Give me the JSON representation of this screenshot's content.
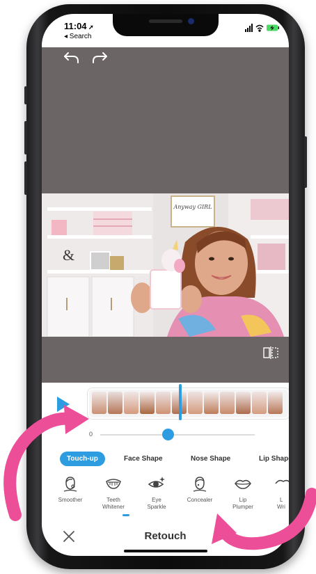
{
  "status_bar": {
    "time": "11:04",
    "back_label": "◂ Search"
  },
  "editor": {
    "undo_icon": "undo-icon",
    "redo_icon": "redo-icon",
    "compare_icon": "compare-split-icon",
    "video_sign_text": "Anyway GIRL"
  },
  "timeline": {
    "play_icon": "play-icon"
  },
  "slider": {
    "min_label": "0",
    "value_fraction": 0.44
  },
  "tabs": [
    {
      "label": "Touch-up",
      "active": true
    },
    {
      "label": "Face Shape",
      "active": false
    },
    {
      "label": "Nose Shape",
      "active": false
    },
    {
      "label": "Lip Shape",
      "active": false
    }
  ],
  "tools": [
    {
      "line1": "Smoother",
      "line2": "",
      "icon": "face-smoother-icon"
    },
    {
      "line1": "Teeth",
      "line2": "Whitener",
      "icon": "teeth-icon"
    },
    {
      "line1": "Eye",
      "line2": "Sparkle",
      "icon": "eye-sparkle-icon"
    },
    {
      "line1": "Concealer",
      "line2": "",
      "icon": "face-concealer-icon"
    },
    {
      "line1": "Lip",
      "line2": "Plumper",
      "icon": "lips-icon"
    },
    {
      "line1": "L",
      "line2": "Wri",
      "icon": "partial-tool-icon"
    }
  ],
  "bottom_bar": {
    "close_icon": "close-icon",
    "title": "Retouch",
    "confirm_icon": "checkmark-icon"
  },
  "colors": {
    "accent": "#2e9ce0",
    "annotation_arrow": "#ec4f97",
    "phone_frame": "#111111"
  }
}
